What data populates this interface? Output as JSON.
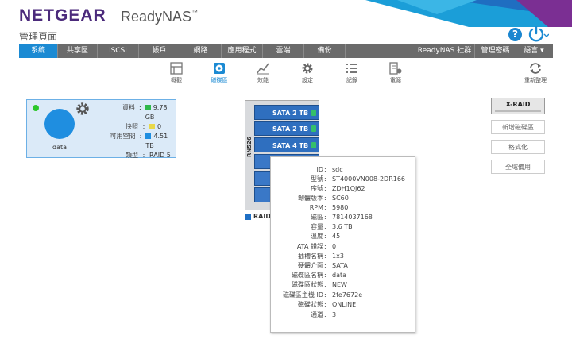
{
  "header": {
    "logo": "NETGEAR",
    "product": "ReadyNAS",
    "trademark": "™",
    "subtitle": "管理頁面",
    "help_icon": "question-icon",
    "power_icon": "power-icon",
    "colors": {
      "logo": "#4b2a7b",
      "accent": "#1b8ad3"
    }
  },
  "menu": [
    {
      "label": "系統",
      "active": true
    },
    {
      "label": "共享區",
      "active": false
    },
    {
      "label": "iSCSI",
      "active": false
    },
    {
      "label": "帳戶",
      "active": false
    },
    {
      "label": "網路",
      "active": false
    },
    {
      "label": "應用程式",
      "active": false
    },
    {
      "label": "雲端",
      "active": false
    },
    {
      "label": "備份",
      "active": false
    },
    {
      "label": "ReadyNAS 社群",
      "active": false
    },
    {
      "label": "管理密碼",
      "active": false
    },
    {
      "label": "語言 ▾",
      "active": false
    }
  ],
  "toolbar": [
    {
      "label": "概觀",
      "icon": "overview-icon",
      "active": false
    },
    {
      "label": "磁碟區",
      "icon": "volumes-icon",
      "active": true
    },
    {
      "label": "效能",
      "icon": "performance-icon",
      "active": false
    },
    {
      "label": "設定",
      "icon": "settings-icon",
      "active": false
    },
    {
      "label": "記錄",
      "icon": "logs-icon",
      "active": false
    },
    {
      "label": "電源",
      "icon": "power-settings-icon",
      "active": false
    },
    {
      "label": "重新整理",
      "icon": "refresh-icon",
      "active": false
    }
  ],
  "volume": {
    "name": "data",
    "stats": [
      {
        "key": "資料",
        "value": "9.78 GB",
        "color": "#2fb84a"
      },
      {
        "key": "快照",
        "value": "0",
        "color": "#e8d84a"
      },
      {
        "key": "可用空間",
        "value": "4.51 TB",
        "color": "#1f8ee0"
      },
      {
        "key": "類型",
        "value": "RAID 5",
        "color": null
      }
    ]
  },
  "chassis": {
    "model": "RN526",
    "side_label": "Inte",
    "bays": [
      "SATA 2 TB",
      "SATA 2 TB",
      "SATA 4 TB",
      "",
      "",
      ""
    ],
    "legend": "RAID"
  },
  "tooltip": [
    {
      "key": "ID",
      "value": "sdc"
    },
    {
      "key": "型號",
      "value": "ST4000VN008-2DR166"
    },
    {
      "key": "序號",
      "value": "ZDH1QJ62"
    },
    {
      "key": "韌體版本",
      "value": "SC60"
    },
    {
      "key": "RPM",
      "value": "5980"
    },
    {
      "key": "磁區",
      "value": "7814037168"
    },
    {
      "key": "容量",
      "value": "3.6 TB"
    },
    {
      "key": "溫度",
      "value": "45"
    },
    {
      "key": "ATA 錯誤",
      "value": "0"
    },
    {
      "key": "插槽名稱",
      "value": "1x3"
    },
    {
      "key": "硬體介面",
      "value": "SATA"
    },
    {
      "key": "磁碟區名稱",
      "value": "data"
    },
    {
      "key": "磁碟區狀態",
      "value": "NEW"
    },
    {
      "key": "磁碟區主機 ID",
      "value": "2fe7672e"
    },
    {
      "key": "磁碟狀態",
      "value": "ONLINE"
    },
    {
      "key": "通道",
      "value": "3"
    }
  ],
  "actions": {
    "xraid": "X-RAID",
    "new_volume": "新增磁碟區",
    "format": "格式化",
    "global_spare": "全域備用"
  }
}
